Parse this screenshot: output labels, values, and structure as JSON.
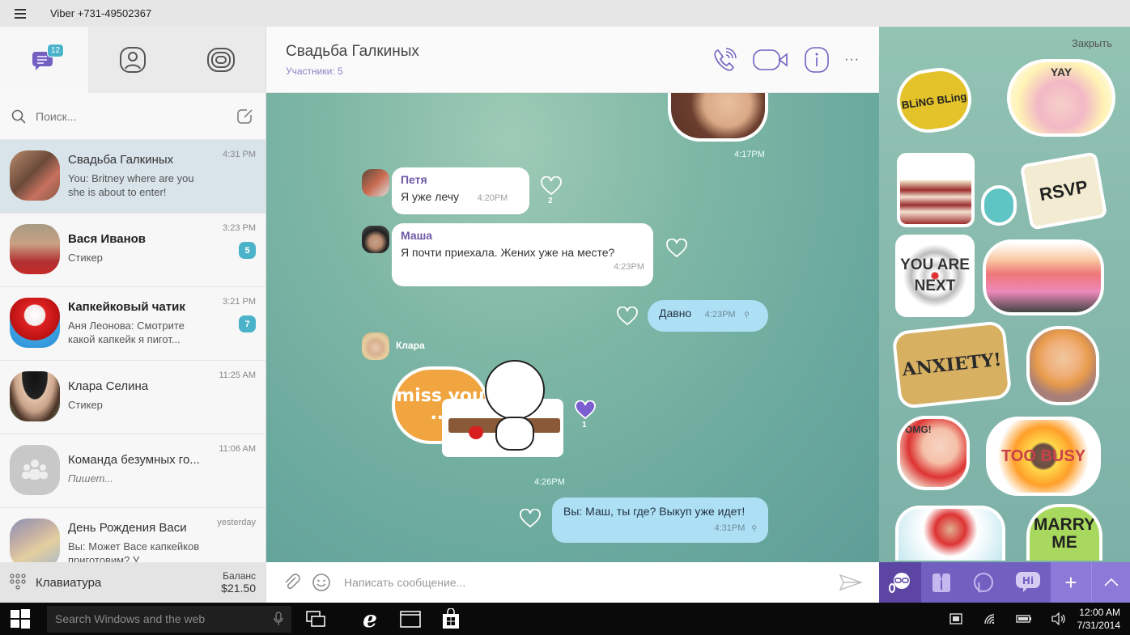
{
  "window": {
    "title": "Viber +731-49502367"
  },
  "left": {
    "tabs": [
      {
        "name": "chats",
        "icon": "chat-bubble-icon",
        "badge": "12"
      },
      {
        "name": "contacts",
        "icon": "contact-icon",
        "badge": ""
      },
      {
        "name": "public",
        "icon": "public-chats-icon",
        "badge": "*"
      }
    ],
    "search_placeholder": "Поиск...",
    "chats": [
      {
        "name": "Свадьба Галкиных",
        "preview": "You: Britney where are you she is about to enter!",
        "time": "4:31 PM",
        "unread": "",
        "bold": false,
        "active": true,
        "italic": false
      },
      {
        "name": "Вася Иванов",
        "preview": "Стикер",
        "time": "3:23 PM",
        "unread": "5",
        "bold": true,
        "active": false,
        "italic": false
      },
      {
        "name": "Капкейковый чатик",
        "preview": "Аня Леонова: Смотрите какой капкейк я пигот...",
        "time": "3:21 PM",
        "unread": "7",
        "bold": true,
        "active": false,
        "italic": false
      },
      {
        "name": "Клара Селина",
        "preview": "Стикер",
        "time": "11:25 AM",
        "unread": "",
        "bold": false,
        "active": false,
        "italic": false
      },
      {
        "name": "Команда безумных го...",
        "preview": "Пишет...",
        "time": "11:06 AM",
        "unread": "",
        "bold": false,
        "active": false,
        "italic": true
      },
      {
        "name": "День Рождения Васи",
        "preview": "Вы: Может Васе капкейков приготовим? У",
        "time": "yesterday",
        "unread": "",
        "bold": false,
        "active": false,
        "italic": false
      }
    ],
    "keypad_label": "Клавиатура",
    "balance_label": "Баланс",
    "balance_value": "$21.50"
  },
  "conversation": {
    "title": "Свадьба Галкиных",
    "subtitle": "Участники: 5",
    "messages": [
      {
        "type": "sticker-out",
        "sticker": "pug",
        "time": "4:17PM"
      },
      {
        "type": "text-in",
        "sender": "Петя",
        "text": "Я уже лечу",
        "time": "4:20PM",
        "likes": "2"
      },
      {
        "type": "text-in",
        "sender": "Маша",
        "text": "Я почти приехала. Жених уже на месте?",
        "time": "4:23PM",
        "likes": ""
      },
      {
        "type": "text-out",
        "text": "Давно",
        "time": "4:23PM",
        "likes": ""
      },
      {
        "type": "sticker-in",
        "sender": "Клара",
        "sticker": "miss you",
        "sticker_text": "miss you ...",
        "time": "4:26PM",
        "likes": "1"
      },
      {
        "type": "text-out",
        "text": "Вы: Маш, ты где? Выкуп уже идет!",
        "time": "4:31PM",
        "likes": ""
      }
    ],
    "composer_placeholder": "Написать сообщение..."
  },
  "stickers": {
    "close_label": "Закрыть",
    "items": [
      {
        "name": "bling",
        "text": "BLiNG BLing"
      },
      {
        "name": "yay",
        "text": "YAY"
      },
      {
        "name": "cake-couple",
        "text": ""
      },
      {
        "name": "money-bag",
        "text": ""
      },
      {
        "name": "rsvp",
        "text": "RSVP"
      },
      {
        "name": "you-are-next",
        "text": "YOU ARE NEXT"
      },
      {
        "name": "party-girls",
        "text": ""
      },
      {
        "name": "anxiety",
        "text": "ANXIETY!"
      },
      {
        "name": "nervous-guy",
        "text": ""
      },
      {
        "name": "omg",
        "text": "OMG!"
      },
      {
        "name": "too-busy",
        "text": "TOO BUSY"
      },
      {
        "name": "bike-couple",
        "text": ""
      },
      {
        "name": "marry-me",
        "text": "MARRY ME"
      }
    ],
    "packs": [
      "geek-pack",
      "suit-pack",
      "elephant-pack",
      "hi-pack"
    ],
    "add_label": "+"
  },
  "taskbar": {
    "search_placeholder": "Search Windows and the web",
    "time": "12:00 AM",
    "date": "7/31/2014"
  },
  "colors": {
    "accent": "#7360c0",
    "badge": "#4ab3c9",
    "outgoing_bubble": "#aee0f5",
    "sticker_bar": "#6d55b5"
  }
}
